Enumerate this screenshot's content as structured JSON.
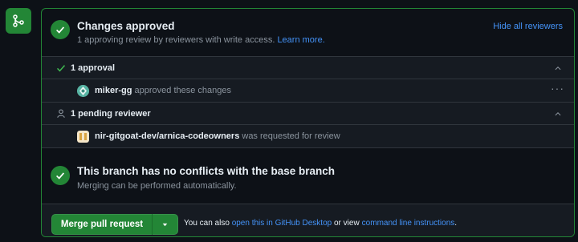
{
  "approval_header": {
    "title": "Changes approved",
    "subtitle": "1 approving review by reviewers with write access.",
    "learn_more": "Learn more.",
    "hide_reviewers": "Hide all reviewers"
  },
  "approvals": {
    "label": "1 approval",
    "items": [
      {
        "user": "miker-gg",
        "text": "approved these changes"
      }
    ]
  },
  "pending": {
    "label": "1 pending reviewer",
    "items": [
      {
        "user": "nir-gitgoat-dev/arnica-codeowners",
        "text": "was requested for review"
      }
    ]
  },
  "conflicts": {
    "title": "This branch has no conflicts with the base branch",
    "subtitle": "Merging can be performed automatically."
  },
  "footer": {
    "merge_button": "Merge pull request",
    "text_prefix": "You can also",
    "desktop_link": "open this in GitHub Desktop",
    "text_middle": "or view",
    "cli_link": "command line instructions",
    "text_suffix": "."
  },
  "colors": {
    "success": "#238636",
    "link": "#4493f8",
    "background": "#0d1117",
    "row_background": "#161b22"
  },
  "icons": {
    "merge": "git-merge-icon",
    "check": "check-icon",
    "person": "person-icon",
    "chevron": "chevron-up-icon",
    "more": "kebab-horizontal-icon"
  }
}
